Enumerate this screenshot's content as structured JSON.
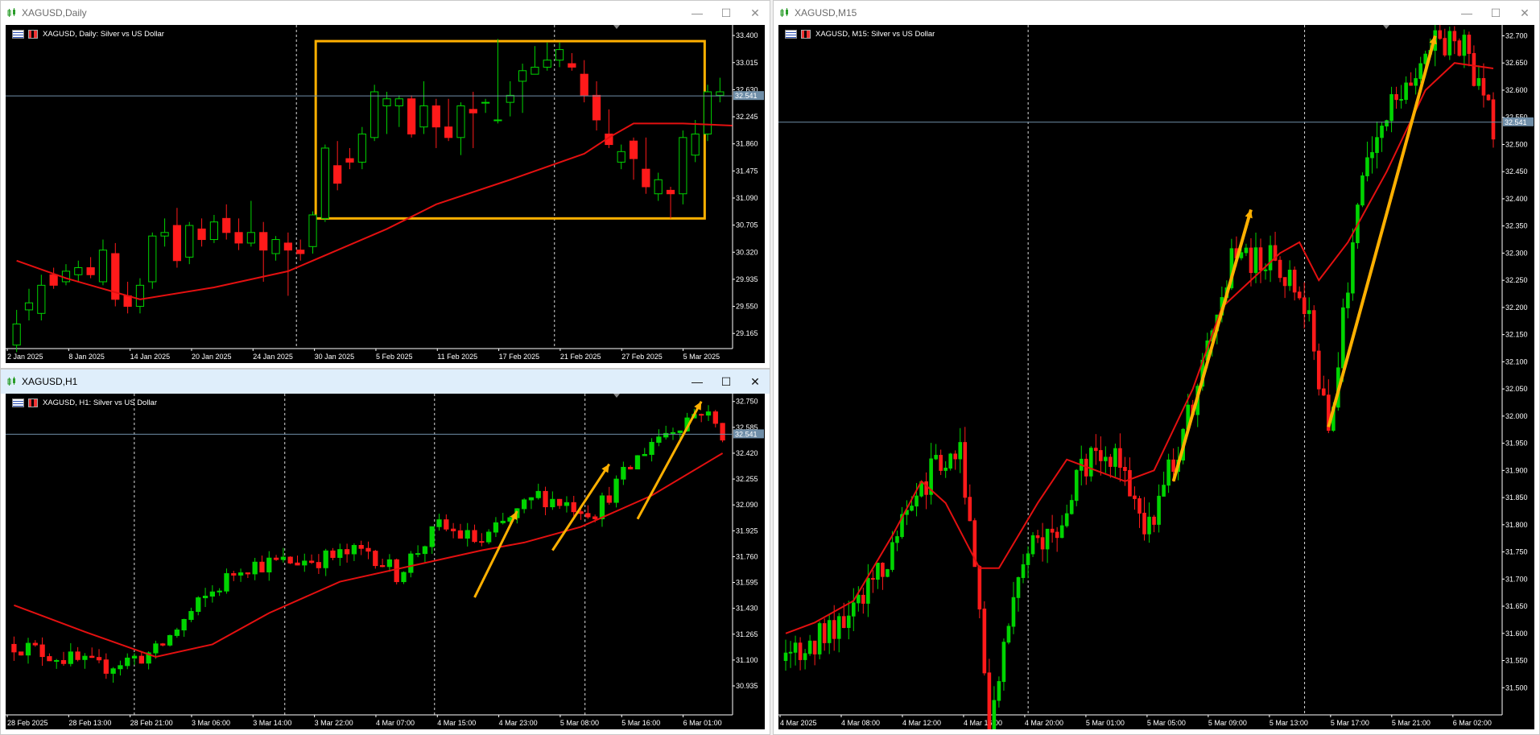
{
  "colors": {
    "bull": "#00d400",
    "bear": "#ff1a1a",
    "ma": "#e31010",
    "grid": "#ffffff",
    "axis": "#ffffff",
    "price_line": "#6f8ea8",
    "arrow": "#ffb000",
    "box": "#ffb000",
    "bg": "#000000"
  },
  "window_controls": {
    "minimize": "—",
    "maximize": "☐",
    "close": "✕"
  },
  "charts": {
    "daily": {
      "title": "XAGUSD,Daily",
      "legend": "XAGUSD, Daily:  Silver vs US Dollar",
      "current_price": "32.541",
      "y_ticks": [
        "33.400",
        "33.015",
        "32.630",
        "32.245",
        "31.860",
        "31.475",
        "31.090",
        "30.705",
        "30.320",
        "29.935",
        "29.550",
        "29.165"
      ],
      "x_labels": [
        "2 Jan 2025",
        "8 Jan 2025",
        "14 Jan 2025",
        "20 Jan 2025",
        "24 Jan 2025",
        "30 Jan 2025",
        "5 Feb 2025",
        "11 Feb 2025",
        "17 Feb 2025",
        "21 Feb 2025",
        "27 Feb 2025",
        "5 Mar 2025"
      ],
      "chart_data": {
        "type": "candlestick",
        "ylim": [
          28.95,
          33.55
        ],
        "ma": [
          [
            0,
            30.2
          ],
          [
            4,
            29.95
          ],
          [
            10,
            29.65
          ],
          [
            16,
            29.82
          ],
          [
            22,
            30.05
          ],
          [
            26,
            30.35
          ],
          [
            30,
            30.65
          ],
          [
            34,
            31.0
          ],
          [
            40,
            31.35
          ],
          [
            46,
            31.72
          ],
          [
            48,
            31.95
          ],
          [
            50,
            32.15
          ],
          [
            54,
            32.15
          ],
          [
            58,
            32.12
          ]
        ],
        "candles": [
          [
            29.0,
            29.3,
            28.9,
            29.5
          ],
          [
            29.5,
            29.6,
            29.35,
            29.8
          ],
          [
            29.45,
            29.85,
            29.35,
            30.0
          ],
          [
            30.0,
            29.85,
            29.8,
            30.1
          ],
          [
            29.9,
            30.05,
            29.85,
            30.15
          ],
          [
            30.0,
            30.1,
            29.9,
            30.2
          ],
          [
            30.1,
            30.0,
            29.95,
            30.25
          ],
          [
            29.9,
            30.35,
            29.85,
            30.5
          ],
          [
            30.3,
            29.65,
            29.55,
            30.45
          ],
          [
            29.7,
            29.55,
            29.45,
            29.9
          ],
          [
            29.55,
            29.85,
            29.45,
            29.95
          ],
          [
            29.9,
            30.55,
            29.8,
            30.6
          ],
          [
            30.55,
            30.6,
            30.4,
            30.8
          ],
          [
            30.7,
            30.2,
            30.1,
            30.95
          ],
          [
            30.25,
            30.7,
            30.15,
            30.75
          ],
          [
            30.65,
            30.5,
            30.4,
            30.8
          ],
          [
            30.5,
            30.75,
            30.45,
            30.85
          ],
          [
            30.8,
            30.6,
            30.5,
            31.0
          ],
          [
            30.6,
            30.45,
            30.35,
            30.8
          ],
          [
            30.45,
            30.6,
            30.4,
            31.05
          ],
          [
            30.6,
            30.35,
            29.9,
            30.75
          ],
          [
            30.3,
            30.5,
            30.2,
            30.55
          ],
          [
            30.45,
            30.35,
            29.7,
            30.6
          ],
          [
            30.35,
            30.3,
            30.2,
            30.5
          ],
          [
            30.4,
            30.85,
            30.3,
            30.9
          ],
          [
            30.8,
            31.8,
            30.75,
            31.85
          ],
          [
            31.55,
            31.3,
            31.2,
            31.9
          ],
          [
            31.65,
            31.6,
            31.5,
            31.8
          ],
          [
            31.6,
            32.0,
            31.5,
            32.1
          ],
          [
            31.95,
            32.6,
            31.9,
            32.7
          ],
          [
            32.4,
            32.5,
            32.0,
            32.6
          ],
          [
            32.4,
            32.5,
            32.1,
            32.55
          ],
          [
            32.5,
            32.0,
            31.95,
            32.55
          ],
          [
            32.1,
            32.4,
            32.0,
            32.75
          ],
          [
            32.4,
            32.1,
            31.8,
            32.5
          ],
          [
            32.1,
            31.95,
            31.9,
            32.5
          ],
          [
            31.95,
            32.4,
            31.7,
            32.45
          ],
          [
            32.35,
            32.3,
            31.8,
            32.6
          ],
          [
            32.45,
            32.45,
            32.3,
            32.5
          ],
          [
            32.2,
            32.2,
            32.15,
            33.35
          ],
          [
            32.45,
            32.55,
            32.25,
            32.75
          ],
          [
            32.75,
            32.9,
            32.3,
            33.0
          ],
          [
            32.85,
            32.95,
            32.85,
            33.25
          ],
          [
            32.95,
            33.05,
            32.9,
            33.3
          ],
          [
            33.05,
            33.2,
            32.95,
            33.3
          ],
          [
            33.0,
            32.95,
            32.9,
            33.15
          ],
          [
            32.85,
            32.55,
            32.45,
            33.05
          ],
          [
            32.55,
            32.2,
            32.05,
            32.75
          ],
          [
            32.0,
            31.85,
            31.8,
            32.35
          ],
          [
            31.6,
            31.75,
            31.5,
            31.85
          ],
          [
            31.9,
            31.65,
            31.35,
            31.95
          ],
          [
            31.5,
            31.25,
            31.15,
            31.95
          ],
          [
            31.15,
            31.35,
            31.05,
            31.45
          ],
          [
            31.2,
            31.15,
            30.8,
            31.25
          ],
          [
            31.15,
            31.95,
            31.0,
            32.05
          ],
          [
            31.7,
            32.0,
            31.6,
            32.2
          ],
          [
            32.0,
            32.6,
            31.9,
            32.7
          ],
          [
            32.55,
            32.6,
            32.45,
            32.8
          ]
        ]
      }
    },
    "h1": {
      "title": "XAGUSD,H1",
      "legend": "XAGUSD, H1:  Silver vs US Dollar",
      "current_price": "32.541",
      "y_ticks": [
        "32.750",
        "32.585",
        "32.420",
        "32.255",
        "32.090",
        "31.925",
        "31.760",
        "31.595",
        "31.430",
        "31.265",
        "31.100",
        "30.935"
      ],
      "x_labels": [
        "28 Feb 2025",
        "28 Feb 13:00",
        "28 Feb 21:00",
        "3 Mar 06:00",
        "3 Mar 14:00",
        "3 Mar 22:00",
        "4 Mar 07:00",
        "4 Mar 15:00",
        "4 Mar 23:00",
        "5 Mar 08:00",
        "5 Mar 16:00",
        "6 Mar 01:00"
      ],
      "chart_data": {
        "type": "candlestick",
        "ylim": [
          30.75,
          32.8
        ]
      }
    },
    "m15": {
      "title": "XAGUSD,M15",
      "legend": "XAGUSD, M15:  Silver vs US Dollar",
      "current_price": "32.541",
      "y_ticks": [
        "32.700",
        "32.650",
        "32.600",
        "32.550",
        "32.500",
        "32.450",
        "32.400",
        "32.350",
        "32.300",
        "32.250",
        "32.200",
        "32.150",
        "32.100",
        "32.050",
        "32.000",
        "31.950",
        "31.900",
        "31.850",
        "31.800",
        "31.750",
        "31.700",
        "31.650",
        "31.600",
        "31.550",
        "31.500"
      ],
      "x_labels": [
        "4 Mar 2025",
        "4 Mar 08:00",
        "4 Mar 12:00",
        "4 Mar 16:00",
        "4 Mar 20:00",
        "5 Mar 01:00",
        "5 Mar 05:00",
        "5 Mar 09:00",
        "5 Mar 13:00",
        "5 Mar 17:00",
        "5 Mar 21:00",
        "6 Mar 02:00"
      ],
      "chart_data": {
        "type": "candlestick",
        "ylim": [
          31.45,
          32.72
        ]
      }
    }
  }
}
